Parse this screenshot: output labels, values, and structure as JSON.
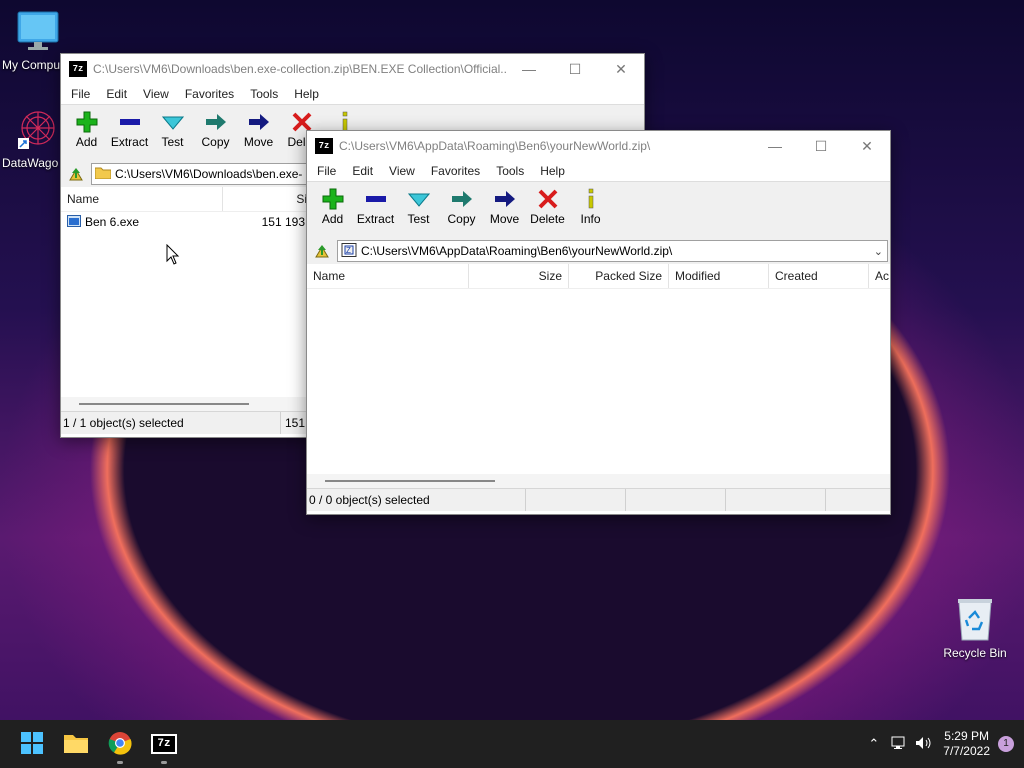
{
  "desktop": {
    "icons": [
      {
        "label": "My Compu",
        "icon": "monitor-icon"
      },
      {
        "label": "DataWago",
        "icon": "datawagon-shortcut-icon"
      },
      {
        "label": "Recycle Bin",
        "icon": "recycle-bin-icon"
      }
    ]
  },
  "back_window": {
    "app_icon": "7z",
    "title": "C:\\Users\\VM6\\Downloads\\ben.exe-collection.zip\\BEN.EXE Collection\\Official...",
    "menu": [
      "File",
      "Edit",
      "View",
      "Favorites",
      "Tools",
      "Help"
    ],
    "toolbar": [
      "Add",
      "Extract",
      "Test",
      "Copy",
      "Move",
      "Delet"
    ],
    "address": "C:\\Users\\VM6\\Downloads\\ben.exe-",
    "columns": [
      "Name",
      "Si"
    ],
    "rows": [
      {
        "name": "Ben 6.exe",
        "size": "151 193 0"
      }
    ],
    "status": [
      "1 / 1 object(s) selected",
      "151"
    ]
  },
  "front_window": {
    "app_icon": "7z",
    "title": "C:\\Users\\VM6\\AppData\\Roaming\\Ben6\\yourNewWorld.zip\\",
    "menu": [
      "File",
      "Edit",
      "View",
      "Favorites",
      "Tools",
      "Help"
    ],
    "toolbar": [
      "Add",
      "Extract",
      "Test",
      "Copy",
      "Move",
      "Delete",
      "Info"
    ],
    "address": "C:\\Users\\VM6\\AppData\\Roaming\\Ben6\\yourNewWorld.zip\\",
    "columns": [
      "Name",
      "Size",
      "Packed Size",
      "Modified",
      "Created",
      "Ac"
    ],
    "status": [
      "0 / 0 object(s) selected",
      "",
      "",
      ""
    ]
  },
  "taskbar": {
    "apps": [
      "start-icon",
      "file-explorer-icon",
      "chrome-icon",
      "7zip-icon"
    ],
    "seven_zip_label": "7z",
    "time": "5:29 PM",
    "date": "7/7/2022",
    "notifications": "1"
  },
  "colors": {
    "add": "#1bb31b",
    "extract": "#1a1aa8",
    "test": "#1aa6b8",
    "copy": "#1f7a6e",
    "move": "#141a80",
    "delete": "#d81c1c",
    "info": "#c8c800"
  }
}
